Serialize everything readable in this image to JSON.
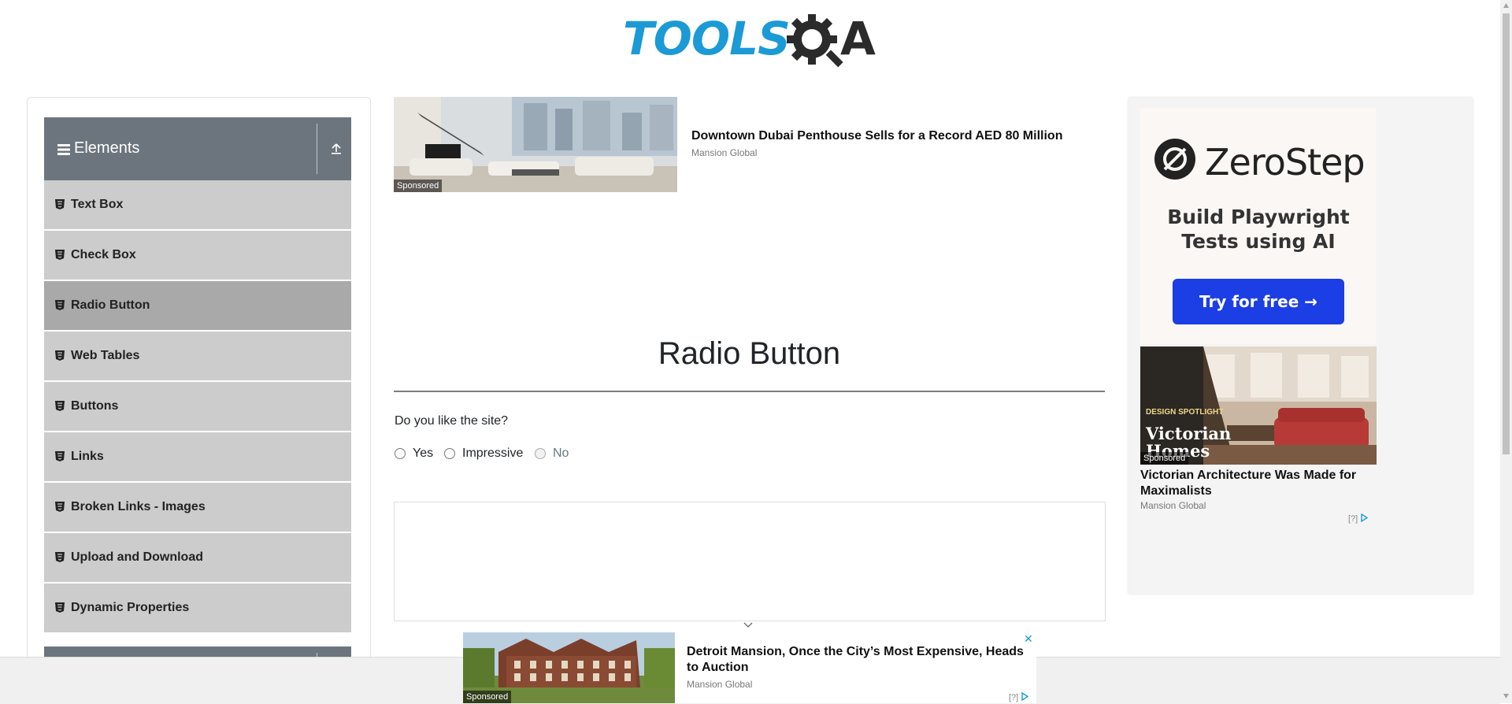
{
  "logo": {
    "left_text": "TOOLS",
    "right_text": "A",
    "alt": "ToolsQA"
  },
  "sidebar": {
    "group_title": "Elements",
    "items": [
      {
        "label": "Text Box",
        "active": false
      },
      {
        "label": "Check Box",
        "active": false
      },
      {
        "label": "Radio Button",
        "active": true
      },
      {
        "label": "Web Tables",
        "active": false
      },
      {
        "label": "Buttons",
        "active": false
      },
      {
        "label": "Links",
        "active": false
      },
      {
        "label": "Broken Links - Images",
        "active": false
      },
      {
        "label": "Upload and Download",
        "active": false
      },
      {
        "label": "Dynamic Properties",
        "active": false
      }
    ]
  },
  "ad_top": {
    "sponsored": "Sponsored",
    "title": "Downtown Dubai Penthouse Sells for a Record AED 80 Million",
    "source": "Mansion Global"
  },
  "main": {
    "title": "Radio Button",
    "question": "Do you like the site?",
    "options": [
      {
        "label": "Yes",
        "disabled": false
      },
      {
        "label": "Impressive",
        "disabled": false
      },
      {
        "label": "No",
        "disabled": true
      }
    ]
  },
  "right_ad": {
    "brand": "ZeroStep",
    "tagline_line1": "Build Playwright",
    "tagline_line2": "Tests using AI",
    "cta": "Try for free →",
    "story_image_kicker": "DESIGN SPOTLIGHT",
    "story_image_heading": "Victorian Homes",
    "sponsored": "Sponsored",
    "story_title": "Victorian Architecture Was Made for Maximalists",
    "story_source": "Mansion Global",
    "adchoice": "[?]"
  },
  "bottom_ad": {
    "sponsored": "Sponsored",
    "title": "Detroit Mansion, Once the City’s Most Expensive, Heads to Auction",
    "source": "Mansion Global",
    "adchoice": "[?]",
    "close": "✕"
  },
  "colors": {
    "brand_blue": "#1b9ad6",
    "sidebar_header": "#6c757d",
    "sidebar_item": "#cccccc",
    "sidebar_item_active": "#a9a9a9",
    "cta_blue": "#1c3ee5"
  }
}
